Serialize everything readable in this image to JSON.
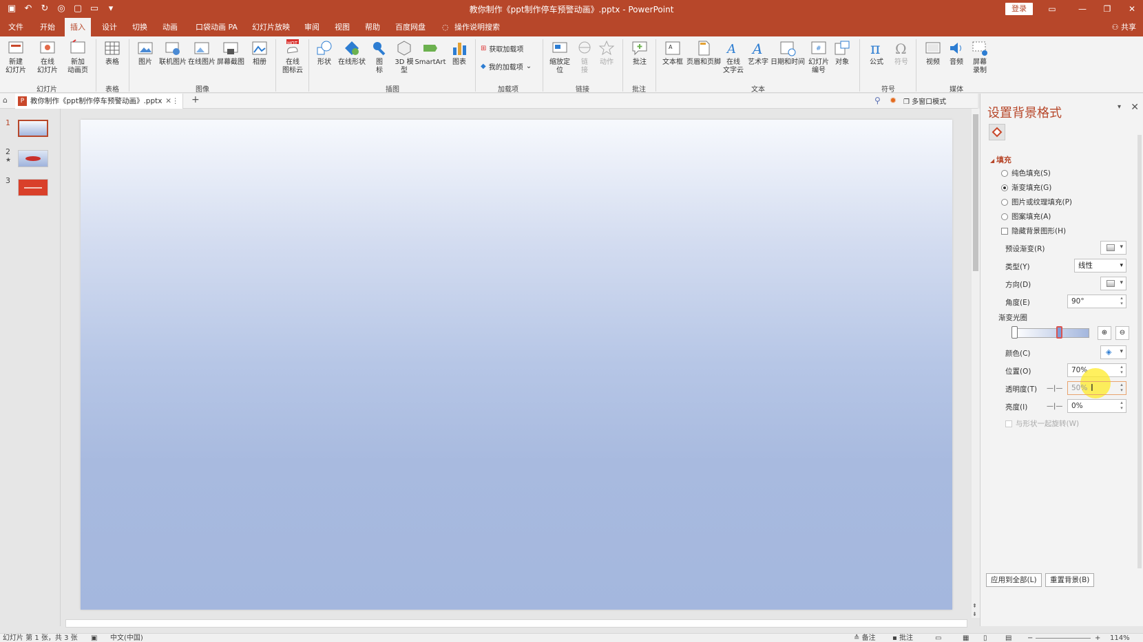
{
  "window": {
    "title": "教你制作《ppt制作停车预警动画》.pptx  -  PowerPoint",
    "login": "登录",
    "share": "共享"
  },
  "tabs": [
    "文件",
    "开始",
    "插入",
    "设计",
    "切换",
    "动画",
    "口袋动画 PA",
    "幻灯片放映",
    "审阅",
    "视图",
    "帮助",
    "百度网盘",
    "操作说明搜索"
  ],
  "active_tab": "插入",
  "ribbon": {
    "buttons": [
      "新建\n幻灯片",
      "在线\n幻灯片",
      "新加\n动画页",
      "表格",
      "图片",
      "联机图片",
      "在线图片",
      "屏幕截图",
      "相册",
      "在线\n图标云",
      "形状",
      "在线形状",
      "图\n标",
      "3D 模\n型",
      "SmartArt",
      "图表",
      "缩放定\n位",
      "链\n接",
      "动作",
      "批注",
      "文本框",
      "页眉和页脚",
      "在线\n文字云",
      "艺术字",
      "日期和时间",
      "幻灯片\n编号",
      "对象",
      "公式",
      "符号",
      "视频",
      "音频",
      "屏幕\n录制"
    ],
    "addins": [
      "获取加载项",
      "我的加载项"
    ],
    "groups": [
      "幻灯片",
      "表格",
      "图像",
      "插图",
      "加载项",
      "链接",
      "批注",
      "文本",
      "符号",
      "媒体"
    ],
    "hot_badge": "HOT"
  },
  "doc_tab": "教你制作《ppt制作停车预警动画》.pptx",
  "multiwindow": "多窗口模式",
  "slides": [
    "1",
    "2",
    "3"
  ],
  "pane": {
    "title": "设置背景格式",
    "section": "填充",
    "fill_options": [
      "纯色填充(S)",
      "渐变填充(G)",
      "图片或纹理填充(P)",
      "图案填充(A)"
    ],
    "selected_fill": "渐变填充(G)",
    "hide_bg": "隐藏背景图形(H)",
    "preset_label": "预设渐变(R)",
    "type_label": "类型(Y)",
    "type_value": "线性",
    "direction_label": "方向(D)",
    "angle_label": "角度(E)",
    "angle_value": "90°",
    "stops_label": "渐变光圈",
    "color_label": "颜色(C)",
    "position_label": "位置(O)",
    "position_value": "70%",
    "transparency_label": "透明度(T)",
    "transparency_value": "50%",
    "brightness_label": "亮度(I)",
    "brightness_value": "0%",
    "rotate_label": "与形状一起旋转(W)",
    "apply_all": "应用到全部(L)",
    "reset_bg": "重置背景(B)"
  },
  "statusbar": {
    "slide_info": "幻灯片 第 1 张，共 3 张",
    "language": "中文(中国)",
    "notes": "备注",
    "comments": "批注",
    "zoom": "114%"
  },
  "colors": {
    "accent": "#b7472a",
    "slide_top": "#f7f9fd",
    "slide_bottom": "#a4b7de"
  }
}
